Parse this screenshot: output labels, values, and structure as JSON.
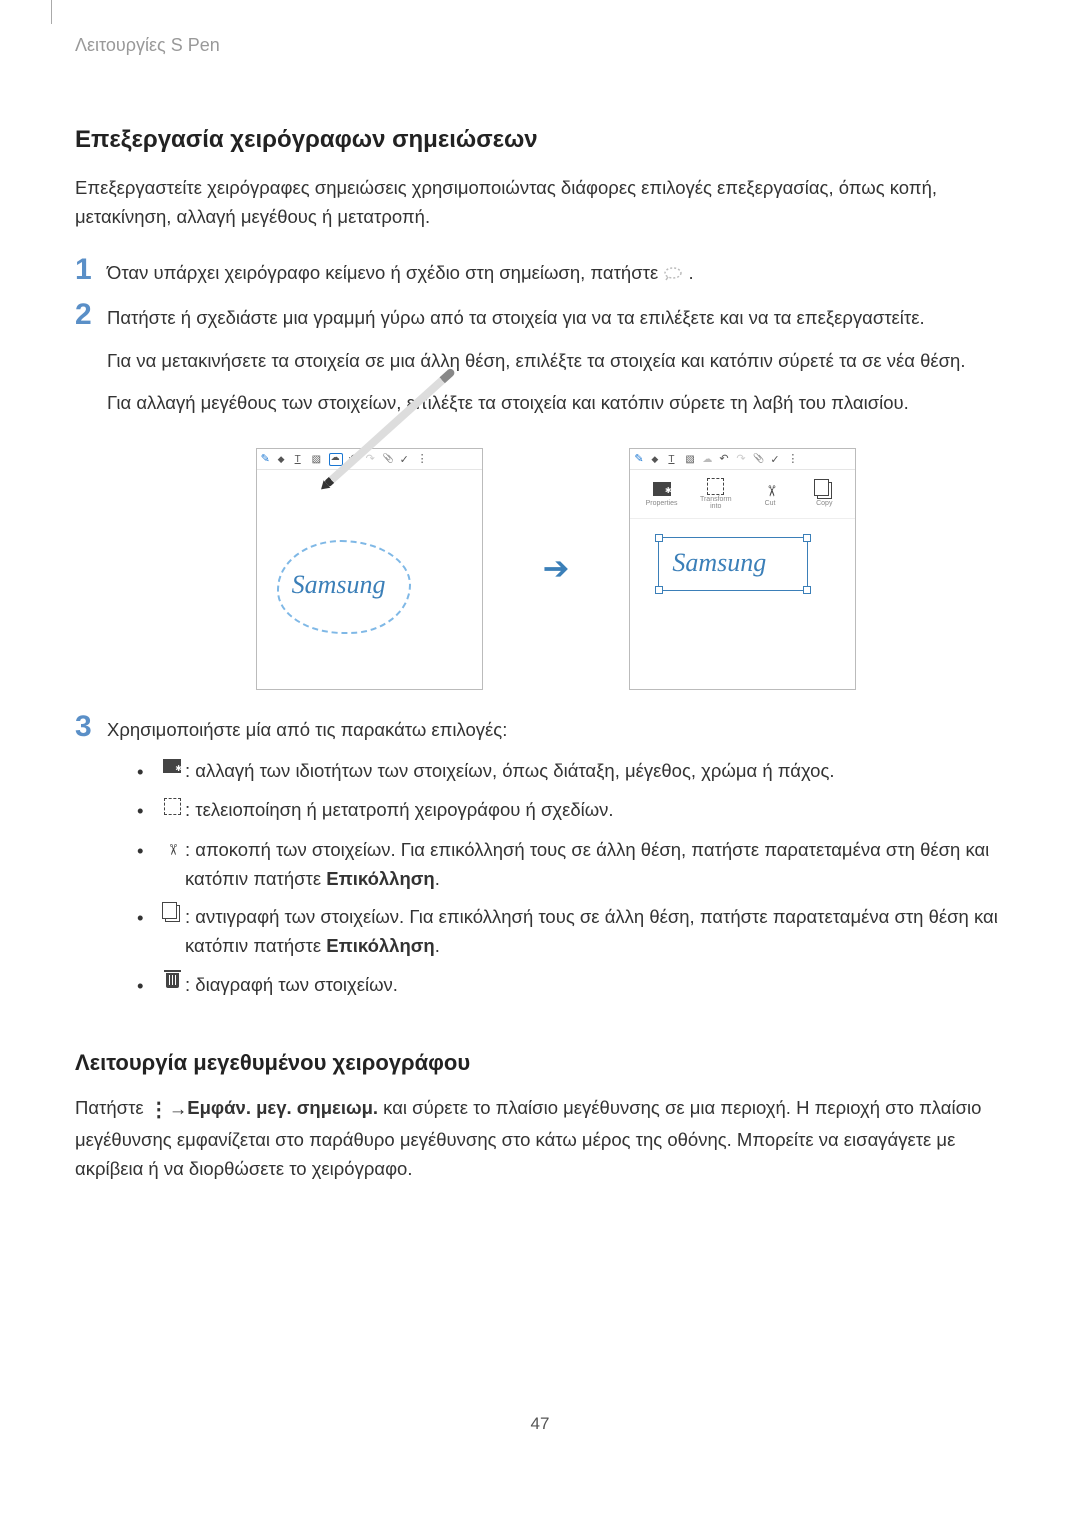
{
  "header": {
    "section_label": "Λειτουργίες S Pen"
  },
  "heading1": "Επεξεργασία χειρόγραφων σημειώσεων",
  "intro": "Επεξεργαστείτε χειρόγραφες σημειώσεις χρησιμοποιώντας διάφορες επιλογές επεξεργασίας, όπως κοπή, μετακίνηση, αλλαγή μεγέθους ή μετατροπή.",
  "steps": {
    "s1": {
      "num": "1",
      "text_a": "Όταν υπάρχει χειρόγραφο κείμενο ή σχέδιο στη σημείωση, πατήστε ",
      "text_b": "."
    },
    "s2": {
      "num": "2",
      "line1": "Πατήστε ή σχεδιάστε μια γραμμή γύρω από τα στοιχεία για να τα επιλέξετε και να τα επεξεργαστείτε.",
      "line2": "Για να μετακινήσετε τα στοιχεία σε μια άλλη θέση, επιλέξτε τα στοιχεία και κατόπιν σύρετέ τα σε νέα θέση.",
      "line3": "Για αλλαγή μεγέθους των στοιχείων, επιλέξτε τα στοιχεία και κατόπιν σύρετε τη λαβή του πλαισίου."
    },
    "s3": {
      "num": "3",
      "text": "Χρησιμοποιήστε μία από τις παρακάτω επιλογές:"
    }
  },
  "illustration": {
    "handwriting": "Samsung",
    "popup": {
      "properties": "Properties",
      "transform": "Transform into",
      "cut": "Cut",
      "copy": "Copy"
    }
  },
  "bullets": {
    "b1": " : αλλαγή των ιδιοτήτων των στοιχείων, όπως διάταξη, μέγεθος, χρώμα ή πάχος.",
    "b2": " : τελειοποίηση ή μετατροπή χειρογράφου ή σχεδίων.",
    "b3a": " : αποκοπή των στοιχείων. Για επικόλλησή τους σε άλλη θέση, πατήστε παρατεταμένα στη θέση και κατόπιν πατήστε ",
    "b3b": "Επικόλληση",
    "b3c": ".",
    "b4a": " : αντιγραφή των στοιχείων. Για επικόλλησή τους σε άλλη θέση, πατήστε παρατεταμένα στη θέση και κατόπιν πατήστε ",
    "b4b": "Επικόλληση",
    "b4c": ".",
    "b5": " : διαγραφή των στοιχείων."
  },
  "heading2": "Λειτουργία μεγεθυμένου χειρογράφου",
  "para2_a": "Πατήστε ",
  "para2_b": " → ",
  "para2_c": "Εμφάν. μεγ. σημειωμ.",
  "para2_d": " και σύρετε το πλαίσιο μεγέθυνσης σε μια περιοχή. Η περιοχή στο πλαίσιο μεγέθυνσης εμφανίζεται στο παράθυρο μεγέθυνσης στο κάτω μέρος της οθόνης. Μπορείτε να εισαγάγετε με ακρίβεια ή να διορθώσετε το χειρόγραφο.",
  "page_number": "47"
}
